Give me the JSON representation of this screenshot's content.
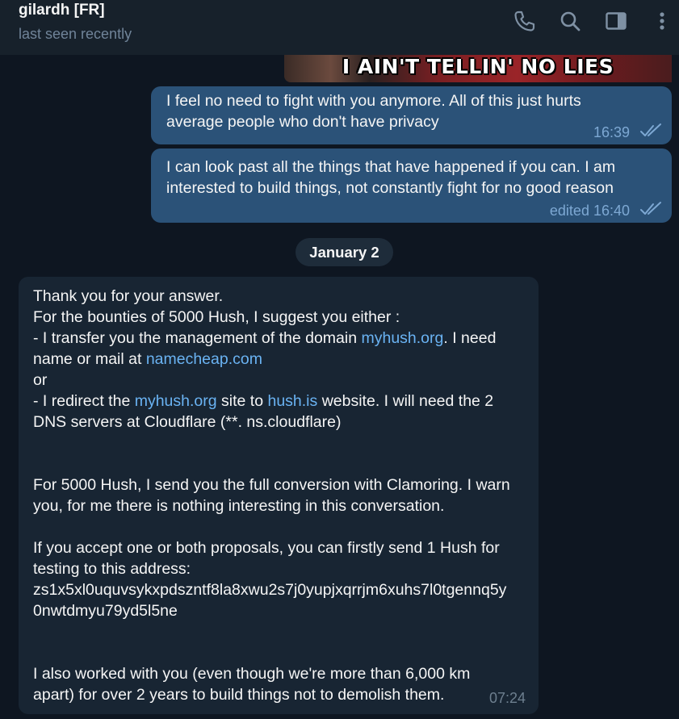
{
  "header": {
    "title": "gilardh [FR]",
    "status": "last seen recently",
    "icons": [
      "phone-icon",
      "search-icon",
      "sidebar-toggle-icon",
      "more-vertical-icon"
    ]
  },
  "gif": {
    "caption": "I AIN'T TELLIN' NO LIES"
  },
  "messages_out": [
    {
      "lines": [
        "I feel no need to fight with you anymore. All of this just hurts",
        "average people who don't have privacy"
      ],
      "time": "16:39"
    },
    {
      "lines": [
        "I can look past all the things that have happened if you can. I am",
        "interested to build things, not constantly fight for no good reason"
      ],
      "time": "edited 16:40"
    }
  ],
  "date_separator": "January 2",
  "message_in": {
    "l1": "Thank you for your answer.",
    "l2": "For the bounties of 5000 Hush, I suggest you either :",
    "l3a": "- I transfer you the management of the domain ",
    "l3_link": "myhush.org",
    "l3b": ". I need",
    "l4a": "name or mail at ",
    "l4_link": "namecheap.com",
    "l5": "or",
    "l6a": "- I redirect the ",
    "l6_link1": "myhush.org",
    "l6b": " site to ",
    "l6_link2": "hush.is",
    "l6c": " website. I will need the 2",
    "l7": "DNS servers at Cloudflare (**. ns.cloudflare)",
    "l8": "For 5000 Hush, I send you the full conversion with Clamoring. I warn",
    "l9": "you, for me there is nothing interesting in this conversation.",
    "l10": "If you accept one or both proposals, you can firstly send 1 Hush for",
    "l11": "testing to this address:",
    "l12": "zs1x5xl0uquvsykxpdszntf8la8xwu2s7j0yupjxqrrjm6xuhs7l0tgennq5y",
    "l13": "0nwtdmyu79yd5l5ne",
    "l14": "I also worked with you (even though we're more than 6,000 km",
    "l15": "apart) for over 2 years to build things not to demolish them.",
    "time": "07:24"
  },
  "colors": {
    "background": "#0e1621",
    "header": "#17212b",
    "outgoing_bubble": "#2b5278",
    "incoming_bubble": "#182533",
    "link": "#6ab3f3",
    "meta_out": "#7da8d3"
  }
}
